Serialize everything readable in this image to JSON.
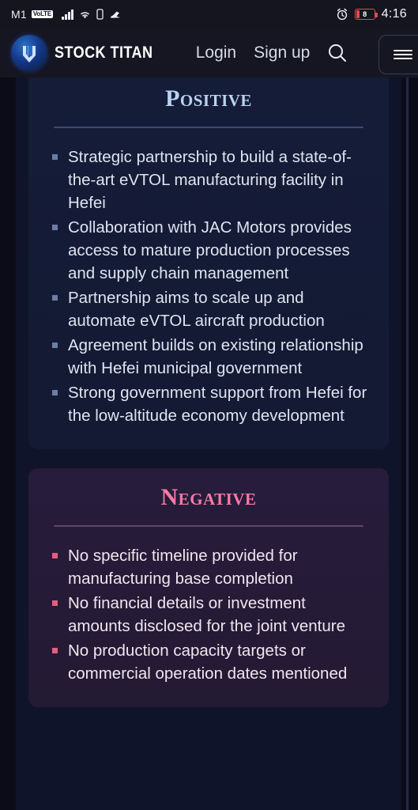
{
  "statusbar": {
    "carrier": "M1",
    "volte_badge": "VoLTE",
    "signal_icon": "signal-bars-icon",
    "wifi_icon": "wifi-icon",
    "sim_icon": "sim-card-icon",
    "misc_icon": "mute-vibrate-icon",
    "alarm_icon": "alarm-clock-icon",
    "battery_percent": "8",
    "time": "4:16"
  },
  "header": {
    "logo_icon": "stock-titan-logo-icon",
    "brand": "STOCK TITAN",
    "nav": [
      {
        "label": "Login"
      },
      {
        "label": "Sign up"
      }
    ],
    "search_icon": "search-icon",
    "menu_icon": "hamburger-menu-icon"
  },
  "sections": [
    {
      "key": "positive",
      "title": "Positive",
      "accent": "#b9d2f2",
      "bullets": [
        "Strategic partnership to build a state-of-the-art eVTOL manufacturing facility in Hefei",
        "Collaboration with JAC Motors provides access to mature production processes and supply chain management",
        "Partnership aims to scale up and automate eVTOL aircraft production",
        "Agreement builds on existing relationship with Hefei municipal government",
        "Strong government support from Hefei for the low-altitude economy development"
      ]
    },
    {
      "key": "negative",
      "title": "Negative",
      "accent": "#f97aa3",
      "bullets": [
        "No specific timeline provided for manufacturing base completion",
        "No financial details or investment amounts disclosed for the joint venture",
        "No production capacity targets or commercial operation dates mentioned"
      ]
    }
  ]
}
